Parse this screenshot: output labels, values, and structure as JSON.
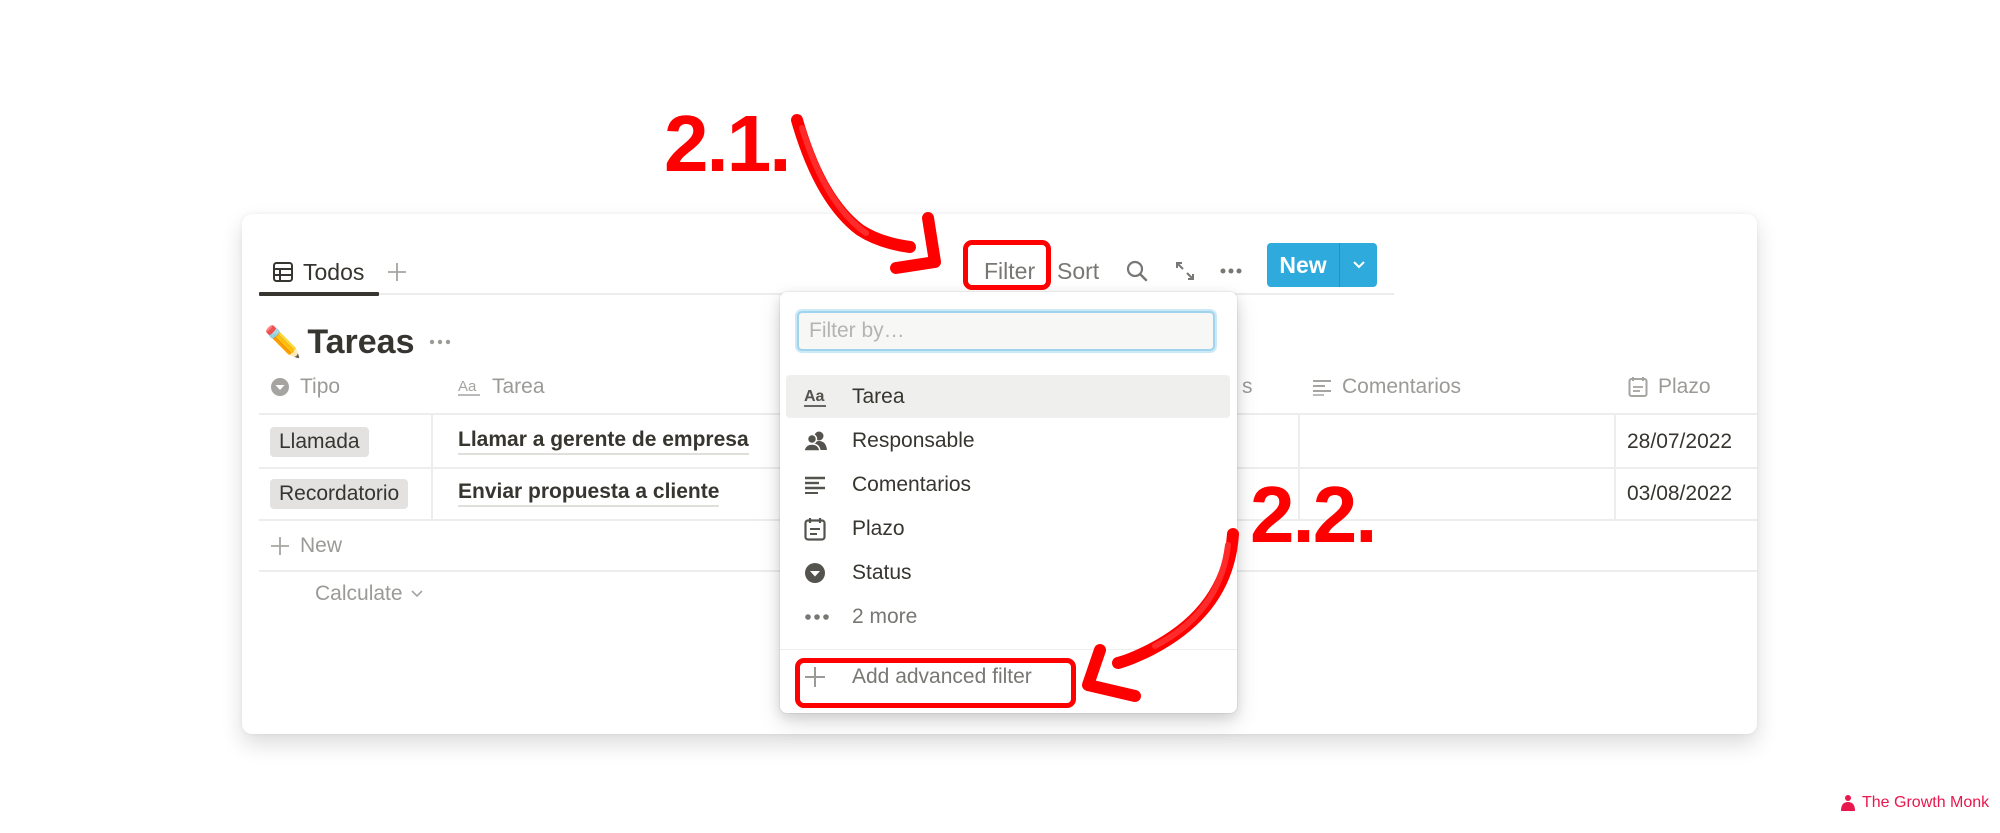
{
  "view": {
    "tabs": [
      {
        "label": "Todos",
        "icon": "table-icon",
        "active": true
      }
    ],
    "add_view_icon": "plus-icon"
  },
  "toolbar": {
    "filter_label": "Filter",
    "sort_label": "Sort",
    "search_icon": "search-icon",
    "expand_icon": "expand-icon",
    "more_icon": "more-icon",
    "new_label": "New",
    "new_dropdown_icon": "chevron-down-icon",
    "accent_color": "#2eaadc"
  },
  "database": {
    "emoji": "✏️",
    "title": "Tareas",
    "columns": [
      {
        "label": "Tipo",
        "icon": "select-icon"
      },
      {
        "label": "Tarea",
        "icon": "text-aa-icon"
      },
      {
        "label": "s",
        "icon": ""
      },
      {
        "label": "Comentarios",
        "icon": "lines-icon"
      },
      {
        "label": "Plazo",
        "icon": "calendar-icon"
      }
    ],
    "rows": [
      {
        "tipo": "Llamada",
        "tarea": "Llamar a gerente de empresa",
        "comentarios": "",
        "plazo": "28/07/2022"
      },
      {
        "tipo": "Recordatorio",
        "tarea": "Enviar propuesta a cliente",
        "comentarios": "",
        "plazo": "03/08/2022"
      }
    ],
    "new_row_label": "New",
    "calculate_label": "Calculate"
  },
  "filter_menu": {
    "input_placeholder": "Filter by…",
    "input_value": "",
    "items": [
      {
        "label": "Tarea",
        "icon": "text-aa-icon",
        "highlighted": true
      },
      {
        "label": "Responsable",
        "icon": "people-icon"
      },
      {
        "label": "Comentarios",
        "icon": "lines-icon"
      },
      {
        "label": "Plazo",
        "icon": "calendar-icon"
      },
      {
        "label": "Status",
        "icon": "select-icon"
      },
      {
        "label": "2 more",
        "icon": "more-icon",
        "muted": true
      }
    ],
    "add_advanced_label": "Add advanced filter"
  },
  "annotations": {
    "step1": "2.1.",
    "step2": "2.2.",
    "color": "#ff0000"
  },
  "watermark": "The Growth Monk"
}
